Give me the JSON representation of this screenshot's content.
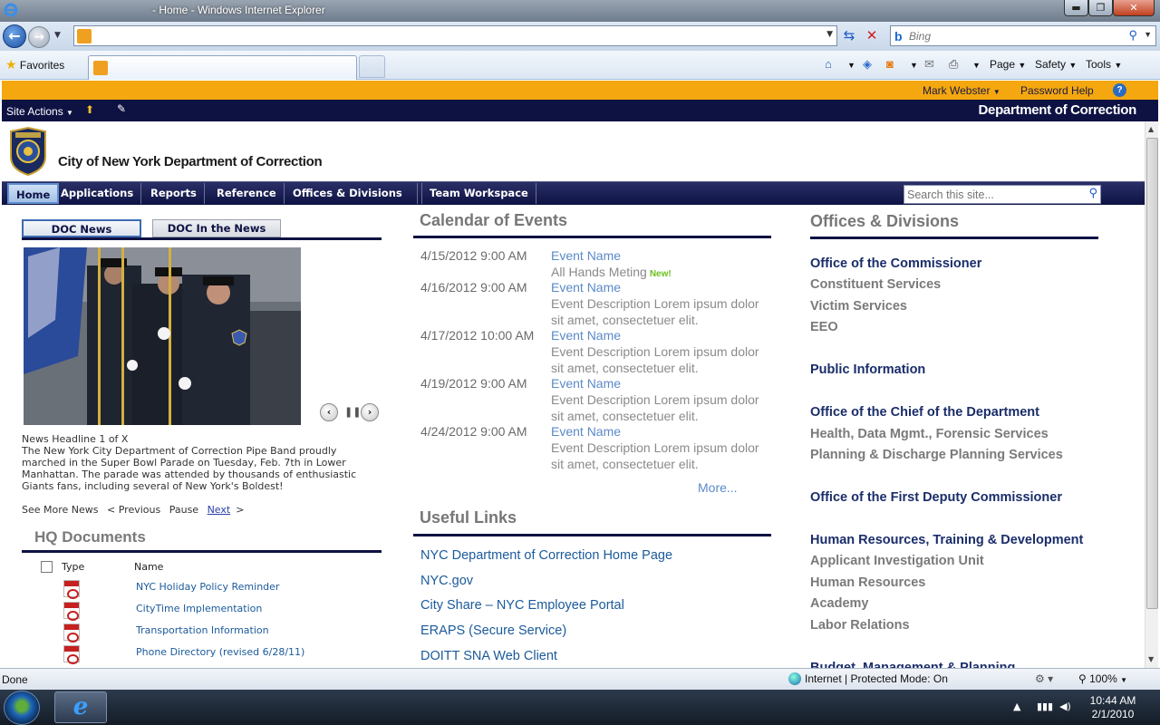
{
  "browser": {
    "window_title": "- Home - Windows Internet Explorer",
    "search_placeholder": "Bing",
    "favorites_label": "Favorites",
    "commands": {
      "page": "Page",
      "safety": "Safety",
      "tools": "Tools"
    },
    "status_text": "Done",
    "zone_text": "Internet | Protected Mode: On",
    "zoom_text": "100%"
  },
  "sharepoint": {
    "user_name": "Mark Webster",
    "password_help": "Password Help",
    "site_actions": "Site Actions",
    "brand": "Department of Correction",
    "site_title": "City of New York Department of Correction",
    "nav": [
      "Home",
      "Applications",
      "Reports",
      "Reference",
      "Offices & Divisions",
      "Team Workspace"
    ],
    "search_placeholder": "Search this site..."
  },
  "news": {
    "tabs": [
      "DOC News",
      "DOC In the News"
    ],
    "headline": "News Headline 1 of X",
    "body": "The New York City Department of Correction Pipe Band proudly marched in the Super Bowl Parade on Tuesday, Feb. 7th in Lower Manhattan. The parade was attended by thousands of enthusiastic Giants fans, including several of New York's Boldest!",
    "see_more": "See More News",
    "previous": "< Previous",
    "pause": "Pause",
    "next": "Next",
    "next_arrow": ">"
  },
  "hq_documents": {
    "title": "HQ Documents",
    "col_type": "Type",
    "col_name": "Name",
    "items": [
      "NYC Holiday Policy Reminder",
      "CityTime Implementation",
      "Transportation Information",
      "Phone Directory (revised 6/28/11)"
    ]
  },
  "calendar": {
    "title": "Calendar of Events",
    "events": [
      {
        "date": "4/15/2012 9:00 AM",
        "name": "Event Name",
        "desc": "All Hands Meting",
        "badge": "New!"
      },
      {
        "date": "4/16/2012 9:00 AM",
        "name": "Event Name",
        "desc": "Event Description Lorem ipsum dolor sit amet, consectetuer elit."
      },
      {
        "date": "4/17/2012 10:00 AM",
        "name": "Event Name",
        "desc": "Event Description Lorem ipsum dolor sit amet, consectetuer elit."
      },
      {
        "date": "4/19/2012 9:00 AM",
        "name": "Event Name",
        "desc": "Event Description Lorem ipsum dolor sit amet, consectetuer elit."
      },
      {
        "date": "4/24/2012 9:00 AM",
        "name": "Event Name",
        "desc": "Event Description Lorem ipsum dolor sit amet, consectetuer elit."
      }
    ],
    "more": "More..."
  },
  "useful_links": {
    "title": "Useful Links",
    "items": [
      "NYC Department of Correction Home Page",
      "NYC.gov",
      "City Share – NYC Employee Portal",
      "ERAPS (Secure Service)",
      "DOITT SNA Web Client"
    ]
  },
  "offices": {
    "title": "Offices & Divisions",
    "groups": [
      {
        "head": "Office of the Commissioner",
        "subs": [
          "Constituent Services",
          "Victim Services",
          "EEO"
        ]
      },
      {
        "head": "Public Information",
        "subs": []
      },
      {
        "head": "Office of the Chief of the Department",
        "subs": [
          "Health, Data Mgmt., Forensic Services",
          "Planning & Discharge Planning Services"
        ]
      },
      {
        "head": "Office of the First Deputy Commissioner",
        "subs": []
      },
      {
        "head": "Human Resources, Training & Development",
        "subs": [
          "Applicant Investigation Unit",
          "Human Resources",
          "Academy",
          "Labor Relations"
        ]
      },
      {
        "head": "Budget, Management & Planning",
        "subs": []
      }
    ]
  },
  "taskbar": {
    "time": "10:44 AM",
    "date": "2/1/2010"
  },
  "icons": {
    "back": "back-arrow-icon",
    "forward": "forward-arrow-icon",
    "refresh": "refresh-icon",
    "stop": "stop-icon",
    "search": "search-icon",
    "favorites": "star-icon",
    "home": "home-icon",
    "feeds": "rss-icon",
    "print": "printer-icon",
    "help": "help-icon",
    "pdf": "pdf-icon"
  },
  "colors": {
    "nav_bg": "#0e1243",
    "orange_bar": "#f4a70f",
    "link": "#1b5a9a",
    "event_link": "#5a8ac8",
    "new_badge": "#6cc020"
  }
}
